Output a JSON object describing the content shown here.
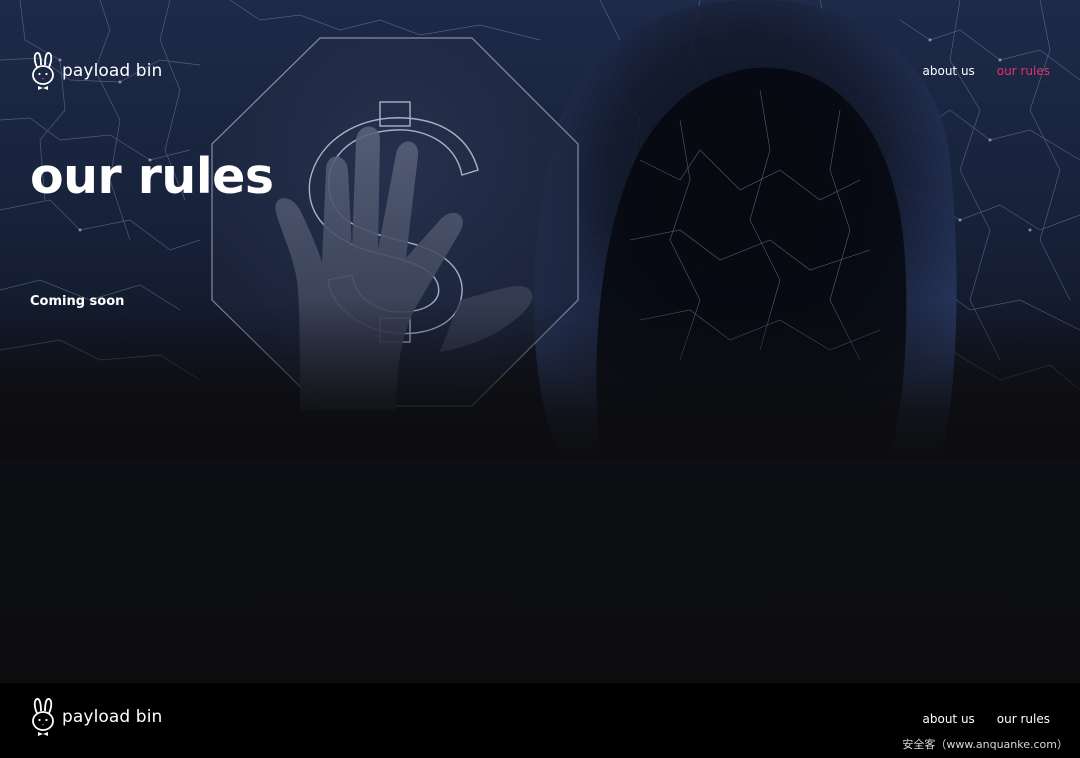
{
  "brand": {
    "name": "payload bin"
  },
  "header": {
    "nav": [
      {
        "label": "about us",
        "active": false
      },
      {
        "label": "our rules",
        "active": true
      }
    ]
  },
  "main": {
    "title": "our rules",
    "body": "Coming soon"
  },
  "footer": {
    "brand_name": "payload bin",
    "nav": [
      {
        "label": "about us"
      },
      {
        "label": "our rules"
      }
    ],
    "watermark": "安全客（www.anquanke.com）"
  },
  "colors": {
    "accent": "#e0336f",
    "footer_bg": "#000000",
    "page_bg": "#0d0d0f",
    "hero_top": "#1d2a48"
  },
  "icons": {
    "logo": "rabbit-logo-icon"
  },
  "hero_image": {
    "subject": "hooded figure, raised hand, dollar sign in octagon, network lines"
  }
}
